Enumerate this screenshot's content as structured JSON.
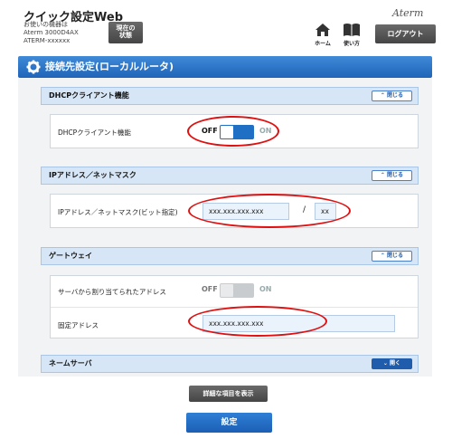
{
  "header": {
    "app_title": "クイック設定Web",
    "device_line1": "お使いの機器は",
    "device_line2": "Aterm 3000D4AX",
    "device_line3": "ATERM-xxxxxx",
    "status_btn_line1": "現在の",
    "status_btn_line2": "状態",
    "logo": "Aterm",
    "home_label": "ホーム",
    "manual_label": "使い方",
    "logout_label": "ログアウト"
  },
  "page": {
    "title": "接続先設定(ローカルルータ)"
  },
  "sections": {
    "dhcp": {
      "title": "DHCPクライアント機能",
      "toggle_label": "閉じる",
      "row_label": "DHCPクライアント機能",
      "switch_off": "OFF",
      "switch_on": "ON",
      "switch_state": "off"
    },
    "ip": {
      "title": "IPアドレス／ネットマスク",
      "toggle_label": "閉じる",
      "row_label": "IPアドレス／ネットマスク(ビット指定)",
      "ip_value": "xxx.xxx.xxx.xxx",
      "separator": "/",
      "mask_value": "xx"
    },
    "gateway": {
      "title": "ゲートウェイ",
      "toggle_label": "閉じる",
      "row1_label": "サーバから割り当てられたアドレス",
      "switch_off": "OFF",
      "switch_on": "ON",
      "switch_state": "off-disabled",
      "row2_label": "固定アドレス",
      "fixed_value": "xxx.xxx.xxx.xxx"
    },
    "dns": {
      "title": "ネームサーバ",
      "toggle_label": "開く"
    }
  },
  "buttons": {
    "detail": "詳細な項目を表示",
    "submit": "設定"
  },
  "colors": {
    "accent": "#1f64b8",
    "highlight": "#e01010",
    "switch_on": "#1f6fc4",
    "switch_disabled": "#c8cccf"
  }
}
